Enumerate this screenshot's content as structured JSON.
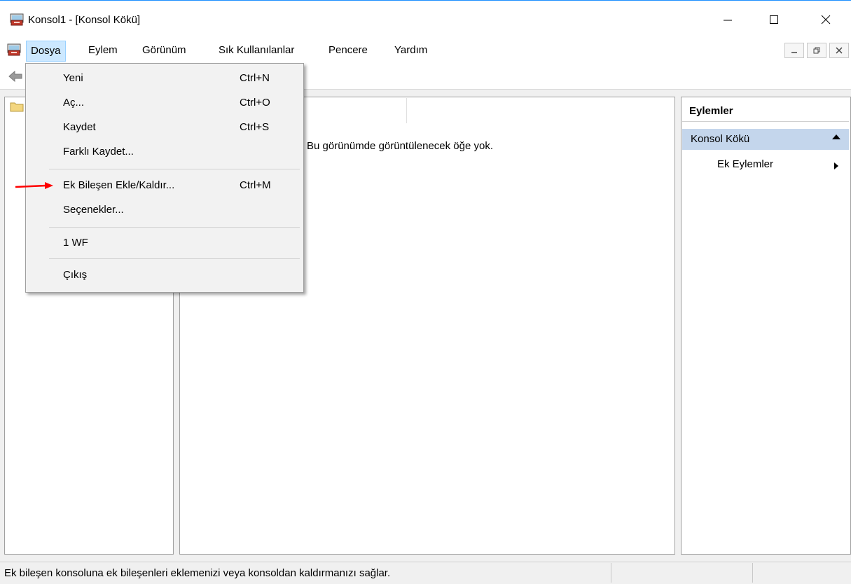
{
  "window": {
    "title": "Konsol1 - [Konsol Kökü]"
  },
  "menubar": {
    "items": [
      "Dosya",
      "Eylem",
      "Görünüm",
      "Sık Kullanılanlar",
      "Pencere",
      "Yardım"
    ]
  },
  "file_menu": {
    "items": [
      {
        "label": "Yeni",
        "shortcut": "Ctrl+N"
      },
      {
        "label": "Aç...",
        "shortcut": "Ctrl+O"
      },
      {
        "label": "Kaydet",
        "shortcut": "Ctrl+S"
      },
      {
        "label": "Farklı Kaydet...",
        "shortcut": ""
      },
      {
        "label": "Ek Bileşen Ekle/Kaldır...",
        "shortcut": "Ctrl+M"
      },
      {
        "label": "Seçenekler...",
        "shortcut": ""
      },
      {
        "label": "1 WF",
        "shortcut": ""
      },
      {
        "label": "Çıkış",
        "shortcut": ""
      }
    ]
  },
  "center": {
    "empty_message": "Bu görünümde görüntülenecek öğe yok."
  },
  "actions": {
    "header": "Eylemler",
    "section": "Konsol Kökü",
    "more_actions": "Ek Eylemler"
  },
  "statusbar": {
    "text": "Ek bileşen konsoluna ek bileşenleri eklemenizi veya konsoldan kaldırmanızı sağlar."
  },
  "colors": {
    "menu_highlight": "#cce8ff",
    "actions_section": "#c4d6ec",
    "annotation_arrow": "#ff0000"
  }
}
